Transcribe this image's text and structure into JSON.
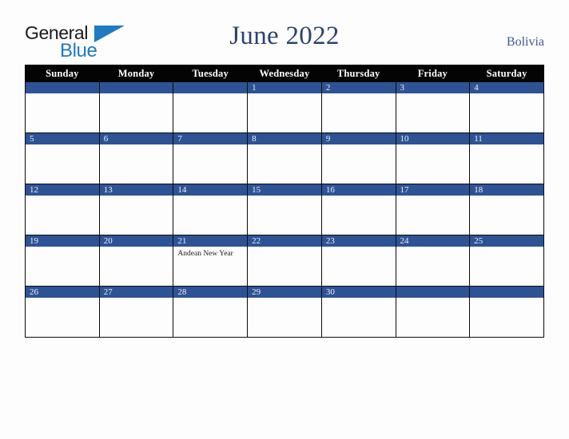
{
  "brand": {
    "name_part1": "General",
    "name_part2": "Blue",
    "triangle_icon": "blue-triangle-icon",
    "accent_color": "#1f7ac4"
  },
  "header": {
    "title": "June 2022",
    "country": "Bolivia",
    "title_color": "#2d4270",
    "country_color": "#3e5a87"
  },
  "calendar": {
    "month": "June",
    "year": "2022",
    "weekday_headers": [
      "Sunday",
      "Monday",
      "Tuesday",
      "Wednesday",
      "Thursday",
      "Friday",
      "Saturday"
    ],
    "header_bg_color": "#040404",
    "daynum_bg_color": "#2e5395",
    "daynum_text_color": "#eef1f7",
    "cell_bg_color": "#fdfdfd",
    "weeks": [
      [
        {
          "day": "",
          "events": []
        },
        {
          "day": "",
          "events": []
        },
        {
          "day": "",
          "events": []
        },
        {
          "day": "1",
          "events": []
        },
        {
          "day": "2",
          "events": []
        },
        {
          "day": "3",
          "events": []
        },
        {
          "day": "4",
          "events": []
        }
      ],
      [
        {
          "day": "5",
          "events": []
        },
        {
          "day": "6",
          "events": []
        },
        {
          "day": "7",
          "events": []
        },
        {
          "day": "8",
          "events": []
        },
        {
          "day": "9",
          "events": []
        },
        {
          "day": "10",
          "events": []
        },
        {
          "day": "11",
          "events": []
        }
      ],
      [
        {
          "day": "12",
          "events": []
        },
        {
          "day": "13",
          "events": []
        },
        {
          "day": "14",
          "events": []
        },
        {
          "day": "15",
          "events": []
        },
        {
          "day": "16",
          "events": []
        },
        {
          "day": "17",
          "events": []
        },
        {
          "day": "18",
          "events": []
        }
      ],
      [
        {
          "day": "19",
          "events": []
        },
        {
          "day": "20",
          "events": []
        },
        {
          "day": "21",
          "events": [
            "Andean New Year"
          ]
        },
        {
          "day": "22",
          "events": []
        },
        {
          "day": "23",
          "events": []
        },
        {
          "day": "24",
          "events": []
        },
        {
          "day": "25",
          "events": []
        }
      ],
      [
        {
          "day": "26",
          "events": []
        },
        {
          "day": "27",
          "events": []
        },
        {
          "day": "28",
          "events": []
        },
        {
          "day": "29",
          "events": []
        },
        {
          "day": "30",
          "events": []
        },
        {
          "day": "",
          "events": []
        },
        {
          "day": "",
          "events": []
        }
      ]
    ]
  }
}
